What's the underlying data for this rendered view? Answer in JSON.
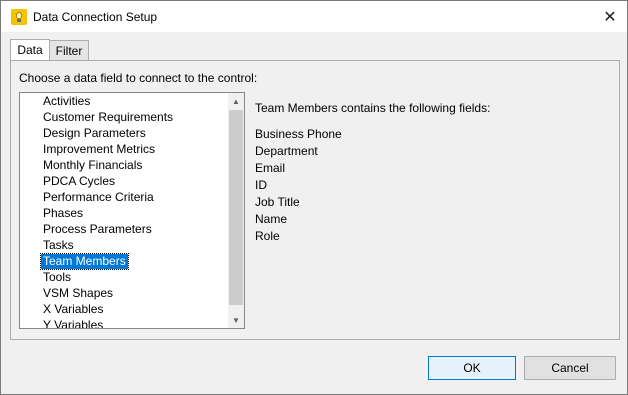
{
  "window": {
    "title": "Data Connection Setup",
    "close_glyph": "✕"
  },
  "tabs": [
    {
      "label": "Data",
      "active": true
    },
    {
      "label": "Filter",
      "active": false
    }
  ],
  "data_tab": {
    "prompt": "Choose a data field to connect to the control:",
    "list_items": [
      "Activities",
      "Customer Requirements",
      "Design Parameters",
      "Improvement Metrics",
      "Monthly Financials",
      "PDCA Cycles",
      "Performance Criteria",
      "Phases",
      "Process Parameters",
      "Tasks",
      "Team Members",
      "Tools",
      "VSM Shapes",
      "X Variables",
      "Y Variables"
    ],
    "selected_item": "Team Members",
    "fields_heading": "Team Members contains the following fields:",
    "fields": [
      "Business Phone",
      "Department",
      "Email",
      "ID",
      "Job Title",
      "Name",
      "Role"
    ]
  },
  "buttons": {
    "ok_label": "OK",
    "cancel_label": "Cancel"
  },
  "colors": {
    "selection": "#0078d7",
    "dialog_bg": "#f0f0f0"
  },
  "icons": {
    "app": "lightbulb-icon",
    "close": "close-icon",
    "scroll_up": "scroll-up-arrow-icon",
    "scroll_down": "scroll-down-arrow-icon"
  }
}
